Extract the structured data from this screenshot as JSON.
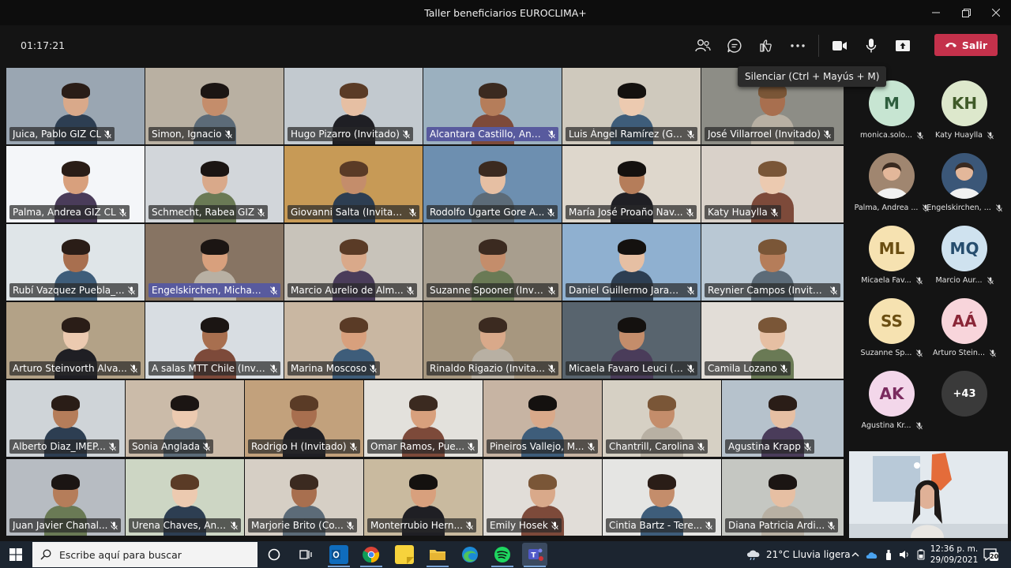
{
  "window": {
    "title": "Taller beneficiarios EUROCLIMA+",
    "controls": [
      "minimize-icon",
      "maximize-icon",
      "close-icon"
    ]
  },
  "toolbar": {
    "timer": "01:17:21",
    "icons": [
      "people-icon",
      "chat-icon",
      "reactions-icon",
      "more-icon",
      "camera-icon",
      "microphone-icon",
      "share-icon"
    ],
    "leave_label": "Salir",
    "tooltip": "Silenciar (Ctrl + Mayús + M)"
  },
  "gallery": {
    "rows": [
      [
        {
          "name": "Juica, Pablo GIZ CL",
          "bg": "#9aa6b2"
        },
        {
          "name": "Simon, Ignacio",
          "bg": "#b9b0a2"
        },
        {
          "name": "Hugo Pizarro (Invitado)",
          "bg": "#c2c9cf"
        },
        {
          "name": "Alcantara Castillo, Ana La...",
          "bg": "#9bb0bf",
          "highlight": true
        },
        {
          "name": "Luis Ángel Ramírez (Gu...",
          "bg": "#cfc9bd"
        },
        {
          "name": "José Villarroel (Invitado)",
          "bg": "#8d8d86"
        }
      ],
      [
        {
          "name": "Palma, Andrea GIZ CL",
          "bg": "#f4f6f9"
        },
        {
          "name": "Schmecht, Rabea GIZ",
          "bg": "#d2d6da"
        },
        {
          "name": "Giovanni Salta (Invitado)",
          "bg": "#c79a56"
        },
        {
          "name": "Rodolfo Ugarte Gore A...",
          "bg": "#6d8fb0"
        },
        {
          "name": "María José Proaño Nav...",
          "bg": "#ded7cc"
        },
        {
          "name": "Katy Huaylla",
          "bg": "#d9d1c9"
        }
      ],
      [
        {
          "name": "Rubí Vazquez Puebla_...",
          "bg": "#dfe5e8"
        },
        {
          "name": "Engelskirchen, Michael GIZ",
          "bg": "#877463",
          "highlight": true
        },
        {
          "name": "Marcio Aurelio de Alm...",
          "bg": "#c8c3ba"
        },
        {
          "name": "Suzanne Spooner (Invi...",
          "bg": "#a89e8e"
        },
        {
          "name": "Daniel Guillermo Jaram...",
          "bg": "#8fb0d0"
        },
        {
          "name": "Reynier Campos (Invita...",
          "bg": "#b9c8d4"
        }
      ],
      [
        {
          "name": "Arturo Steinvorth Alva...",
          "bg": "#b3a287"
        },
        {
          "name": "A salas MTT Chile (Invit...",
          "bg": "#d8dde2"
        },
        {
          "name": "Marina Moscoso",
          "bg": "#c9b7a2"
        },
        {
          "name": "Rinaldo Rigazio (Invita...",
          "bg": "#a7977f"
        },
        {
          "name": "Micaela Favaro Leuci (I...",
          "bg": "#58646e"
        },
        {
          "name": "Camila Lozano",
          "bg": "#e2ddd7"
        }
      ],
      [
        {
          "name": "Alberto Diaz_IMEP...",
          "bg": "#cfd4d8"
        },
        {
          "name": "Sonia Anglada",
          "bg": "#cbbba9"
        },
        {
          "name": "Rodrigo H (Invitado)",
          "bg": "#c2a17c"
        },
        {
          "name": "Omar Ramos, Pue...",
          "bg": "#e3e1dc"
        },
        {
          "name": "Pineiros Vallejo, M...",
          "bg": "#c7b4a3"
        },
        {
          "name": "Chantrill, Carolina",
          "bg": "#d6d0c4"
        },
        {
          "name": "Agustina Krapp",
          "bg": "#b6c2cc"
        }
      ],
      [
        {
          "name": "Juan Javier Chanal...",
          "bg": "#b7bcc2"
        },
        {
          "name": "Urena Chaves, Ana...",
          "bg": "#cdd6c4"
        },
        {
          "name": "Marjorie Brito (Co...",
          "bg": "#d6cfc5"
        },
        {
          "name": "Monterrubio Hern...",
          "bg": "#c9ba9f"
        },
        {
          "name": "Emily Hosek",
          "bg": "#e1ddd8"
        },
        {
          "name": "Cintia Bartz - Tere...",
          "bg": "#e5e5e3"
        },
        {
          "name": "Diana Patricia Ardi...",
          "bg": "#c5c7c2"
        }
      ]
    ]
  },
  "participants_panel": {
    "items": [
      {
        "initials": "M",
        "name": "monica.solo...",
        "bg": "#c7e5d2",
        "fg": "#2e5e3e"
      },
      {
        "initials": "KH",
        "name": "Katy Huaylla",
        "bg": "#dde8cc",
        "fg": "#3f5a28"
      },
      {
        "initials": "",
        "name": "Palma, Andrea ...",
        "bg": "#a08670",
        "fg": "#fff"
      },
      {
        "initials": "",
        "name": "Engelskirchen, ...",
        "bg": "#3b5778",
        "fg": "#fff"
      },
      {
        "initials": "ML",
        "name": "Micaela Fav...",
        "bg": "#f6e2b1",
        "fg": "#6b4e12"
      },
      {
        "initials": "MQ",
        "name": "Marcio Aur...",
        "bg": "#cfe2ef",
        "fg": "#264d6e"
      },
      {
        "initials": "SS",
        "name": "Suzanne Sp...",
        "bg": "#f6e2b1",
        "fg": "#6b4e12"
      },
      {
        "initials": "AÁ",
        "name": "Arturo Stein...",
        "bg": "#f8d5db",
        "fg": "#8a2637"
      },
      {
        "initials": "AK",
        "name": "Agustina Kr...",
        "bg": "#f3d7ea",
        "fg": "#7a2a5e"
      }
    ],
    "more_count": "+43"
  },
  "taskbar": {
    "search_placeholder": "Escribe aquí para buscar",
    "apps": [
      "task-view-icon",
      "taskview-icon",
      "outlook-icon",
      "chrome-icon",
      "sticky-notes-icon",
      "file-explorer-icon",
      "edge-icon",
      "spotify-icon",
      "teams-icon"
    ],
    "weather": "21°C  Lluvia ligera",
    "time": "12:36 p. m.",
    "date": "29/09/2021",
    "notifications": "20"
  },
  "colors": {
    "leave": "#c4314b",
    "highlight_tag": "#585a9e",
    "taskbar": "#1c2530"
  }
}
